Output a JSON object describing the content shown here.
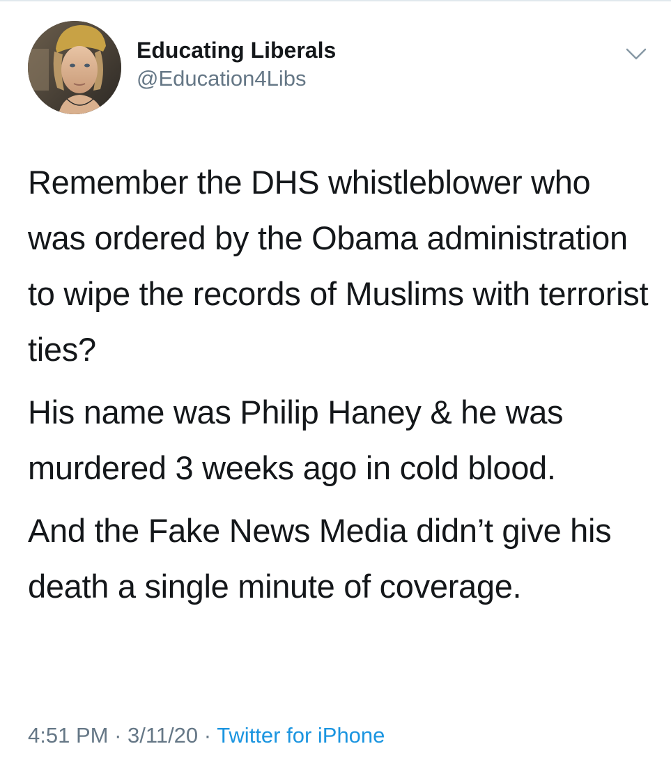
{
  "author": {
    "display_name": "Educating Liberals",
    "handle": "@Education4Libs",
    "avatar_icon": "profile-photo"
  },
  "menu": {
    "icon": "chevron-down-icon"
  },
  "tweet": {
    "paragraphs": [
      "Remember the DHS whistleblower who was ordered by the Obama administration to wipe the records of Muslims with terrorist ties?",
      "His name was Philip Haney & he was murdered 3 weeks ago in cold blood.",
      "And the Fake News Media didn’t give his death a single minute of coverage."
    ]
  },
  "meta": {
    "time": "4:51 PM",
    "separator": "·",
    "date": "3/11/20",
    "source": "Twitter for iPhone"
  },
  "colors": {
    "text": "#14171a",
    "secondary": "#657786",
    "link": "#1b95e0",
    "divider": "#e1e8ed"
  }
}
